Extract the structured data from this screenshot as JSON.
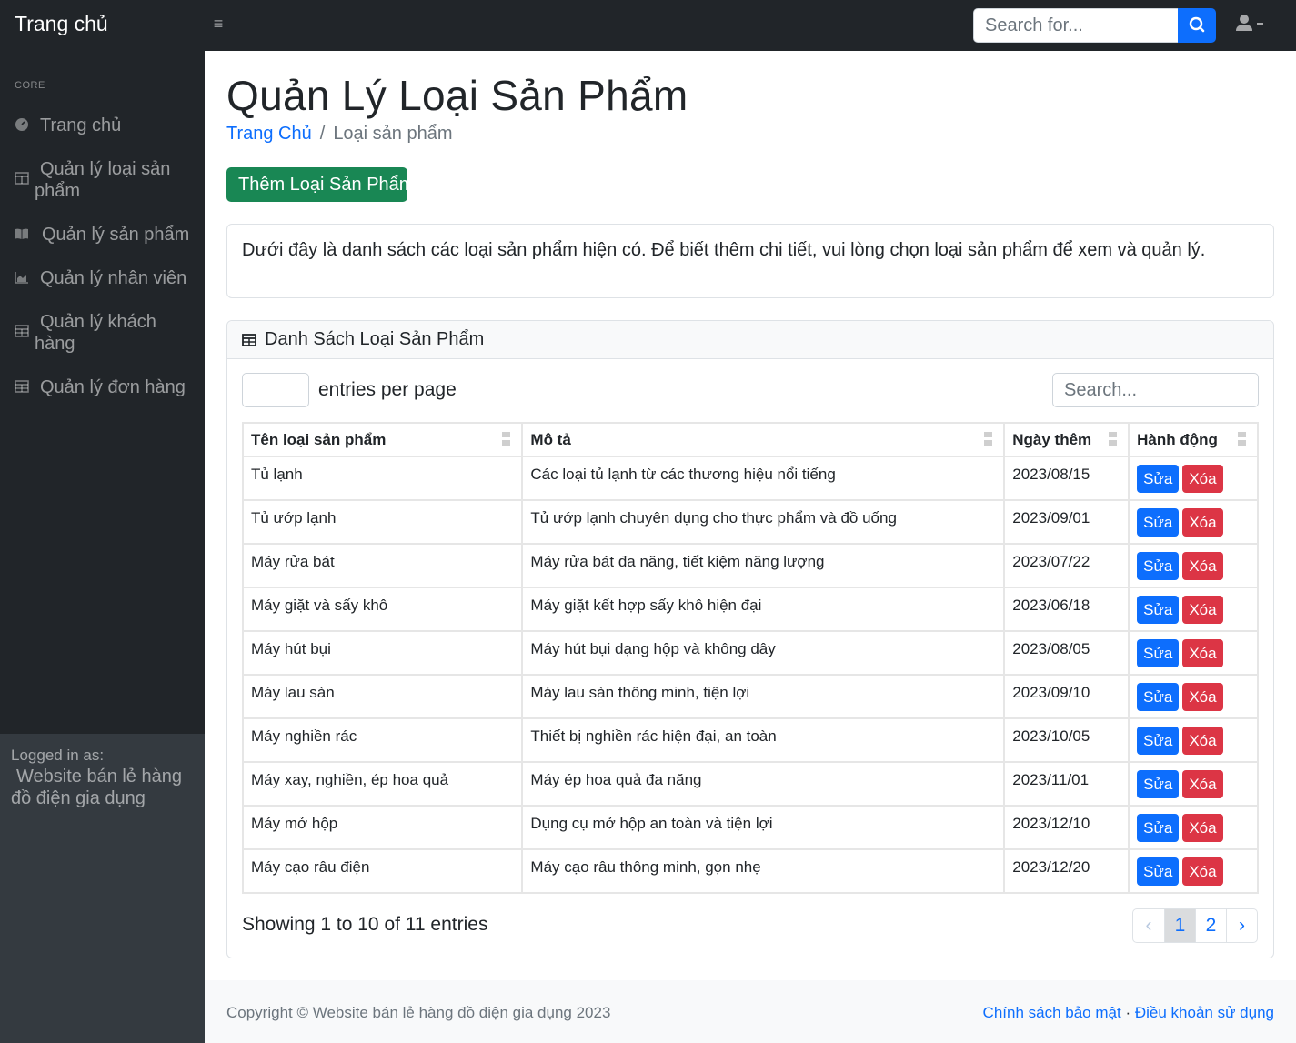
{
  "navbar": {
    "brand": "Trang chủ",
    "search_placeholder": "Search for..."
  },
  "sidebar": {
    "heading": "CORE",
    "items": [
      {
        "label": "Trang chủ",
        "icon": "dashboard-icon"
      },
      {
        "label": "Quản lý loại sản phẩm",
        "icon": "columns-icon"
      },
      {
        "label": "Quản lý sản phẩm",
        "icon": "book-icon"
      },
      {
        "label": "Quản lý nhân viên",
        "icon": "chart-area-icon"
      },
      {
        "label": "Quản lý khách hàng",
        "icon": "table-icon"
      },
      {
        "label": "Quản lý đơn hàng",
        "icon": "table-icon"
      }
    ],
    "logged_in_label": "Logged in as:",
    "logged_in_name": "Website bán lẻ hàng đồ điện gia dụng"
  },
  "page": {
    "title": "Quản Lý Loại Sản Phẩm",
    "breadcrumb": {
      "home": "Trang Chủ",
      "sep": "/",
      "current": "Loại sản phẩm"
    },
    "add_button": "Thêm Loại Sản Phẩm",
    "intro": "Dưới đây là danh sách các loại sản phẩm hiện có. Để biết thêm chi tiết, vui lòng chọn loại sản phẩm để xem và quản lý."
  },
  "table_card": {
    "header": "Danh Sách Loại Sản Phẩm",
    "per_page_value": "",
    "per_page_label": "entries per page",
    "search_placeholder": "Search...",
    "columns": [
      "Tên loại sản phẩm",
      "Mô tả",
      "Ngày thêm",
      "Hành động"
    ],
    "rows": [
      {
        "name": "Tủ lạnh",
        "desc": "Các loại tủ lạnh từ các thương hiệu nổi tiếng",
        "date": "2023/08/15"
      },
      {
        "name": "Tủ ướp lạnh",
        "desc": "Tủ ướp lạnh chuyên dụng cho thực phẩm và đồ uống",
        "date": "2023/09/01"
      },
      {
        "name": "Máy rửa bát",
        "desc": "Máy rửa bát đa năng, tiết kiệm năng lượng",
        "date": "2023/07/22"
      },
      {
        "name": "Máy giặt và sấy khô",
        "desc": "Máy giặt kết hợp sấy khô hiện đại",
        "date": "2023/06/18"
      },
      {
        "name": "Máy hút bụi",
        "desc": "Máy hút bụi dạng hộp và không dây",
        "date": "2023/08/05"
      },
      {
        "name": "Máy lau sàn",
        "desc": "Máy lau sàn thông minh, tiện lợi",
        "date": "2023/09/10"
      },
      {
        "name": "Máy nghiền rác",
        "desc": "Thiết bị nghiền rác hiện đại, an toàn",
        "date": "2023/10/05"
      },
      {
        "name": "Máy xay, nghiền, ép hoa quả",
        "desc": "Máy ép hoa quả đa năng",
        "date": "2023/11/01"
      },
      {
        "name": "Máy mở hộp",
        "desc": "Dụng cụ mở hộp an toàn và tiện lợi",
        "date": "2023/12/10"
      },
      {
        "name": "Máy cạo râu điện",
        "desc": "Máy cạo râu thông minh, gọn nhẹ",
        "date": "2023/12/20"
      }
    ],
    "edit_label": "Sửa",
    "delete_label": "Xóa",
    "showing": "Showing 1 to 10 of 11 entries",
    "pagination": {
      "prev": "‹",
      "pages": [
        "1",
        "2"
      ],
      "current": "1",
      "next": "›"
    }
  },
  "footer": {
    "copyright": "Copyright © Website bán lẻ hàng đồ điện gia dụng 2023",
    "privacy": "Chính sách bảo mật",
    "dot": "·",
    "terms": "Điều khoản sử dụng"
  },
  "colors": {
    "primary": "#0d6efd",
    "success": "#198754",
    "danger": "#dc3545",
    "dark": "#212529"
  }
}
